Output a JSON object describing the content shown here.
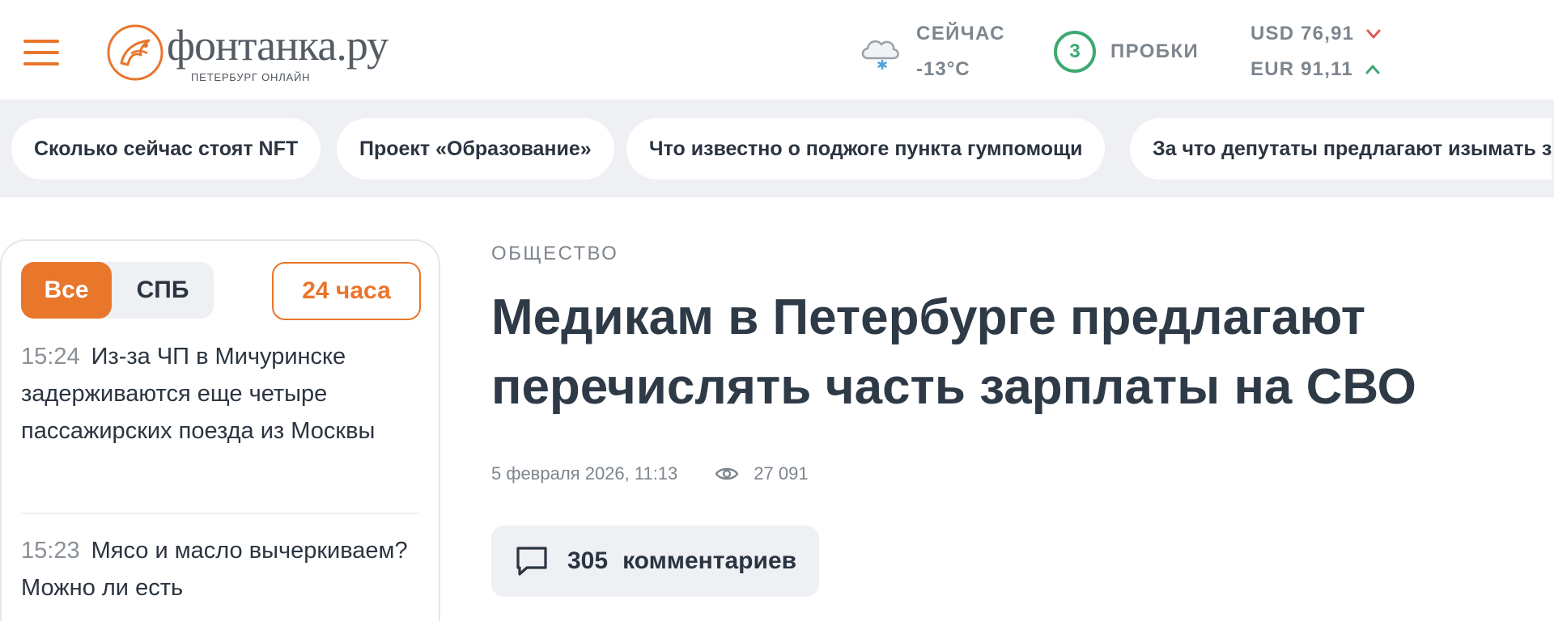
{
  "header": {
    "logo_name": "фонтанка.ру",
    "logo_subtitle": "ПЕТЕРБУРГ ОНЛАЙН",
    "weather": {
      "label": "СЕЙЧАС",
      "temperature": "-13°C",
      "icon": "cloud-snow-icon"
    },
    "traffic": {
      "level": "3",
      "label": "ПРОБКИ",
      "color": "#3fa872"
    },
    "currency": [
      {
        "text": "USD 76,91",
        "trend": "down",
        "trend_color": "#e05a5a"
      },
      {
        "text": "EUR 91,11",
        "trend": "up",
        "trend_color": "#3fa872"
      }
    ],
    "accent_color": "#e8762b"
  },
  "trending": [
    "Сколько сейчас стоят NFT",
    "Проект «Образование»",
    "Что известно о поджоге пункта гумпомощи",
    "За что депутаты предлагают изымать з"
  ],
  "feed": {
    "tabs": [
      "Все",
      "СПБ"
    ],
    "active_tab": "Все",
    "period": "24 часа",
    "items": [
      {
        "time": "15:24",
        "title": "Из-за ЧП в Мичуринске задерживаются еще четыре пассажирских поезда из Москвы"
      },
      {
        "time": "15:23",
        "title": "Мясо и масло вычеркиваем? Можно ли есть"
      }
    ]
  },
  "article": {
    "rubric": "ОБЩЕСТВО",
    "headline": "Медикам в Петербурге предлагают перечислять часть зарплаты на СВО",
    "date": "5 февраля 2026, 11:13",
    "views": "27 091",
    "comments_count": "305",
    "comments_label": "комментариев"
  }
}
